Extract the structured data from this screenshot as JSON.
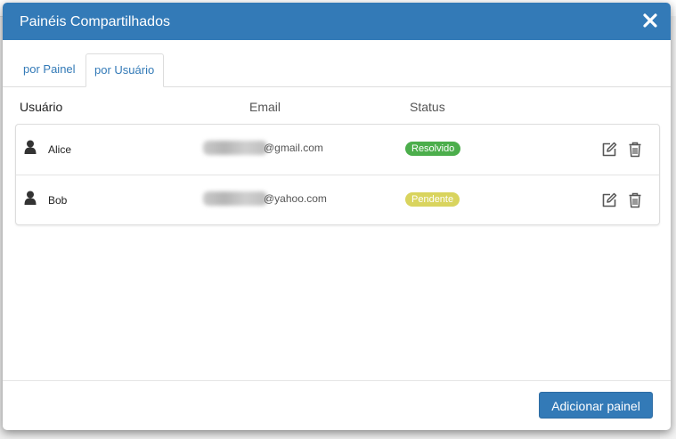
{
  "modal": {
    "title": "Painéis Compartilhados",
    "close_icon": "close-icon"
  },
  "tabs": [
    {
      "label": "por Painel",
      "active": false
    },
    {
      "label": "por Usuário",
      "active": true
    }
  ],
  "table": {
    "headers": {
      "user": "Usuário",
      "email": "Email",
      "status": "Status"
    },
    "rows": [
      {
        "user": "Alice",
        "email_visible": "@gmail.com",
        "status": "Resolvido",
        "status_color": "#4cae4c"
      },
      {
        "user": "Bob",
        "email_visible": "@yahoo.com",
        "status": "Pendente",
        "status_color": "#d9d45e"
      }
    ],
    "row_icons": {
      "user": "user-icon",
      "edit": "edit-icon",
      "delete": "trash-icon"
    }
  },
  "footer": {
    "add_button_label": "Adicionar painel"
  },
  "colors": {
    "primary": "#337ab7",
    "header_bg": "#337ab7"
  }
}
